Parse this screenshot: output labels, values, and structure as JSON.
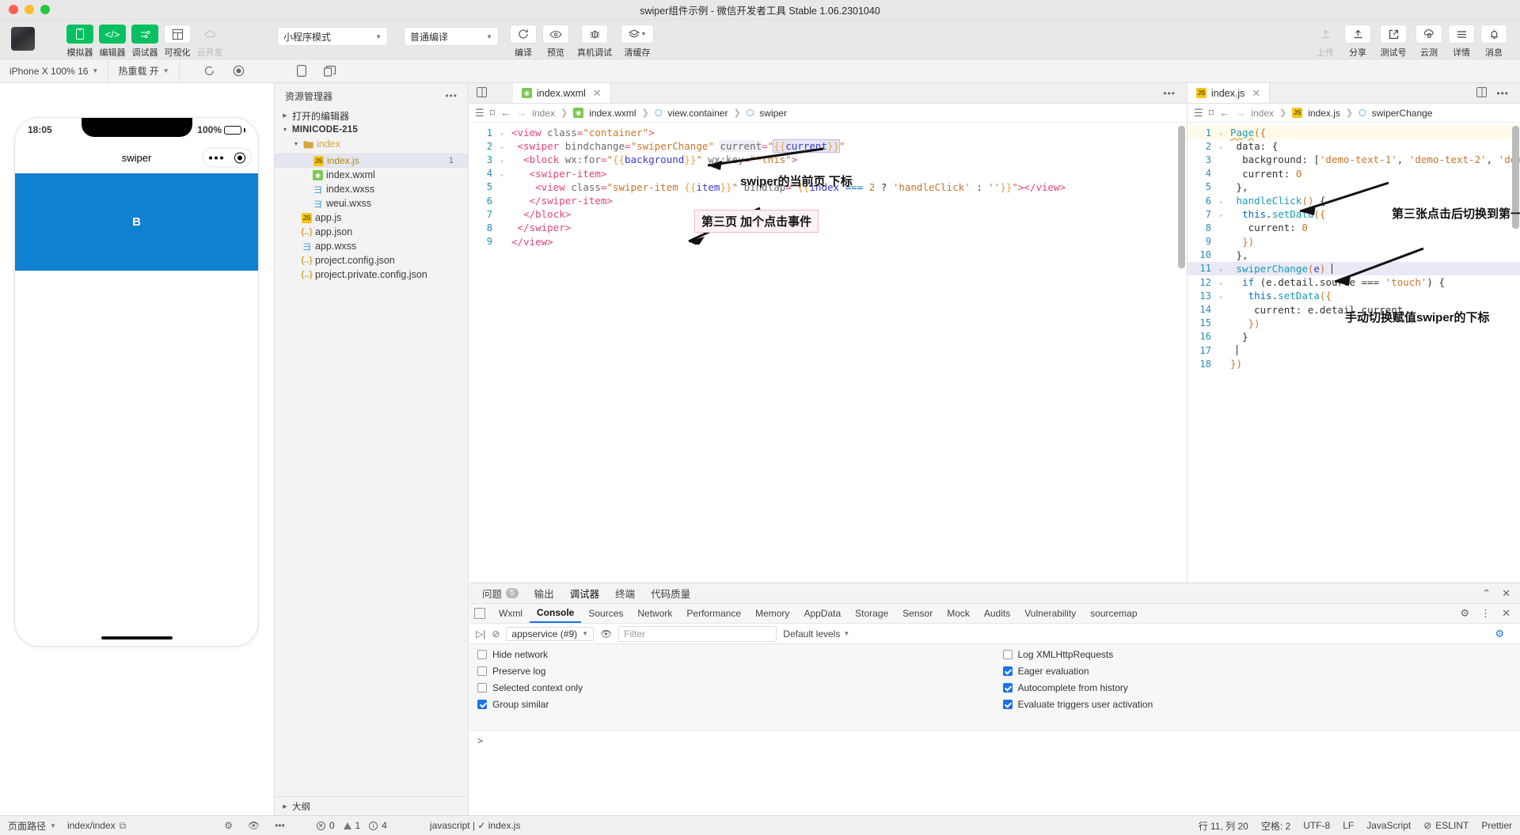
{
  "window": {
    "title": "swiper组件示例 - 微信开发者工具 Stable 1.06.2301040"
  },
  "toolbar": {
    "buttons": [
      {
        "label": "模拟器",
        "icon": "phone-icon",
        "state": "green"
      },
      {
        "label": "编辑器",
        "icon": "code-icon",
        "state": "green"
      },
      {
        "label": "调试器",
        "icon": "sliders-icon",
        "state": "green"
      },
      {
        "label": "可视化",
        "icon": "layout-icon",
        "state": "white"
      },
      {
        "label": "云开发",
        "icon": "cloud-icon",
        "state": "disabled"
      }
    ],
    "mode_select": "小程序模式",
    "compile_select": "普通编译",
    "actions": [
      {
        "label": "编译",
        "icon": "refresh-icon"
      },
      {
        "label": "预览",
        "icon": "eye-icon"
      },
      {
        "label": "真机调试",
        "icon": "bug-icon"
      },
      {
        "label": "清缓存",
        "icon": "layers-icon"
      }
    ],
    "right_actions": [
      {
        "label": "上传",
        "icon": "upload-icon",
        "state": "disabled"
      },
      {
        "label": "分享",
        "icon": "share-icon",
        "state": "normal"
      },
      {
        "label": "测试号",
        "icon": "external-link-icon",
        "state": "normal"
      },
      {
        "label": "云测",
        "icon": "cloud-test-icon",
        "state": "normal"
      },
      {
        "label": "详情",
        "icon": "menu-icon",
        "state": "normal"
      },
      {
        "label": "消息",
        "icon": "bell-icon",
        "state": "normal"
      }
    ]
  },
  "subbar": {
    "device": "iPhone X 100% 16",
    "hotreload": "热重载 开",
    "icons": [
      "refresh-icon",
      "record-icon",
      "phone-icon",
      "copy-icon"
    ]
  },
  "simulator": {
    "status_time": "18:05",
    "battery": "100%",
    "nav_title": "swiper",
    "slide_label": "B",
    "slide_color": "#1080d0"
  },
  "explorer": {
    "title": "资源管理器",
    "open_editors": "打开的编辑器",
    "project": "MINICODE-215",
    "outline": "大纲",
    "items": [
      {
        "label": "index",
        "type": "folder",
        "depth": 1,
        "expanded": true
      },
      {
        "label": "index.js",
        "type": "js",
        "depth": 2,
        "selected": true,
        "badge": "1"
      },
      {
        "label": "index.wxml",
        "type": "wxml",
        "depth": 2
      },
      {
        "label": "index.wxss",
        "type": "wxss",
        "depth": 2
      },
      {
        "label": "weui.wxss",
        "type": "wxss",
        "depth": 2
      },
      {
        "label": "app.js",
        "type": "js",
        "depth": 1
      },
      {
        "label": "app.json",
        "type": "json",
        "depth": 1
      },
      {
        "label": "app.wxss",
        "type": "wxss",
        "depth": 1
      },
      {
        "label": "project.config.json",
        "type": "json",
        "depth": 1
      },
      {
        "label": "project.private.config.json",
        "type": "json",
        "depth": 1
      }
    ]
  },
  "editor_wxml": {
    "tab": "index.wxml",
    "breadcrumb": [
      "index",
      "index.wxml",
      "view.container",
      "swiper"
    ],
    "lines": [
      {
        "n": 1,
        "fold": true
      },
      {
        "n": 2,
        "fold": true
      },
      {
        "n": 3,
        "fold": true
      },
      {
        "n": 4,
        "fold": true
      },
      {
        "n": 5,
        "fold": false
      },
      {
        "n": 6,
        "fold": false
      },
      {
        "n": 7,
        "fold": false
      },
      {
        "n": 8,
        "fold": false
      },
      {
        "n": 9,
        "fold": false
      }
    ]
  },
  "editor_js": {
    "tab": "index.js",
    "breadcrumb": [
      "index",
      "index.js",
      "swiperChange"
    ],
    "lines": [
      {
        "n": 1,
        "fold": true
      },
      {
        "n": 2,
        "fold": true
      },
      {
        "n": 3,
        "fold": false
      },
      {
        "n": 4,
        "fold": false
      },
      {
        "n": 5,
        "fold": false
      },
      {
        "n": 6,
        "fold": true
      },
      {
        "n": 7,
        "fold": true
      },
      {
        "n": 8,
        "fold": false
      },
      {
        "n": 9,
        "fold": false
      },
      {
        "n": 10,
        "fold": false
      },
      {
        "n": 11,
        "fold": true
      },
      {
        "n": 12,
        "fold": true
      },
      {
        "n": 13,
        "fold": true
      },
      {
        "n": 14,
        "fold": false
      },
      {
        "n": 15,
        "fold": false
      },
      {
        "n": 16,
        "fold": false
      },
      {
        "n": 17,
        "fold": false
      },
      {
        "n": 18,
        "fold": false
      }
    ]
  },
  "annotations": [
    {
      "text": "swiper的当前页 下标",
      "boxed": false
    },
    {
      "text": "第三页 加个点击事件",
      "boxed": true
    },
    {
      "text": "第三张点击后切换到第一张",
      "boxed": false
    },
    {
      "text": "手动切换赋值swiper的下标",
      "boxed": false
    }
  ],
  "devtools": {
    "tabs": [
      {
        "label": "问题",
        "count": "5"
      },
      {
        "label": "输出"
      },
      {
        "label": "调试器",
        "active": true
      },
      {
        "label": "终端"
      },
      {
        "label": "代码质量"
      }
    ],
    "panels": [
      "Wxml",
      "Console",
      "Sources",
      "Network",
      "Performance",
      "Memory",
      "AppData",
      "Storage",
      "Sensor",
      "Mock",
      "Audits",
      "Vulnerability",
      "sourcemap"
    ],
    "active_panel": "Console",
    "context": "appservice (#9)",
    "filter_placeholder": "Filter",
    "levels": "Default levels",
    "settings_left": [
      {
        "label": "Hide network",
        "checked": false
      },
      {
        "label": "Preserve log",
        "checked": false
      },
      {
        "label": "Selected context only",
        "checked": false
      },
      {
        "label": "Group similar",
        "checked": true
      }
    ],
    "settings_right": [
      {
        "label": "Log XMLHttpRequests",
        "checked": false
      },
      {
        "label": "Eager evaluation",
        "checked": true
      },
      {
        "label": "Autocomplete from history",
        "checked": true
      },
      {
        "label": "Evaluate triggers user activation",
        "checked": true
      }
    ],
    "prompt": ">"
  },
  "statusbar": {
    "page_path": "页面路径",
    "route": "index/index",
    "errors": "0",
    "warnings": "1",
    "infos": "4",
    "lang_file": "javascript | ✓ index.js",
    "cursor": "行 11, 列 20",
    "spaces": "空格: 2",
    "encoding": "UTF-8",
    "eol": "LF",
    "language": "JavaScript",
    "eslint": "ESLINT",
    "prettier": "Prettier"
  }
}
